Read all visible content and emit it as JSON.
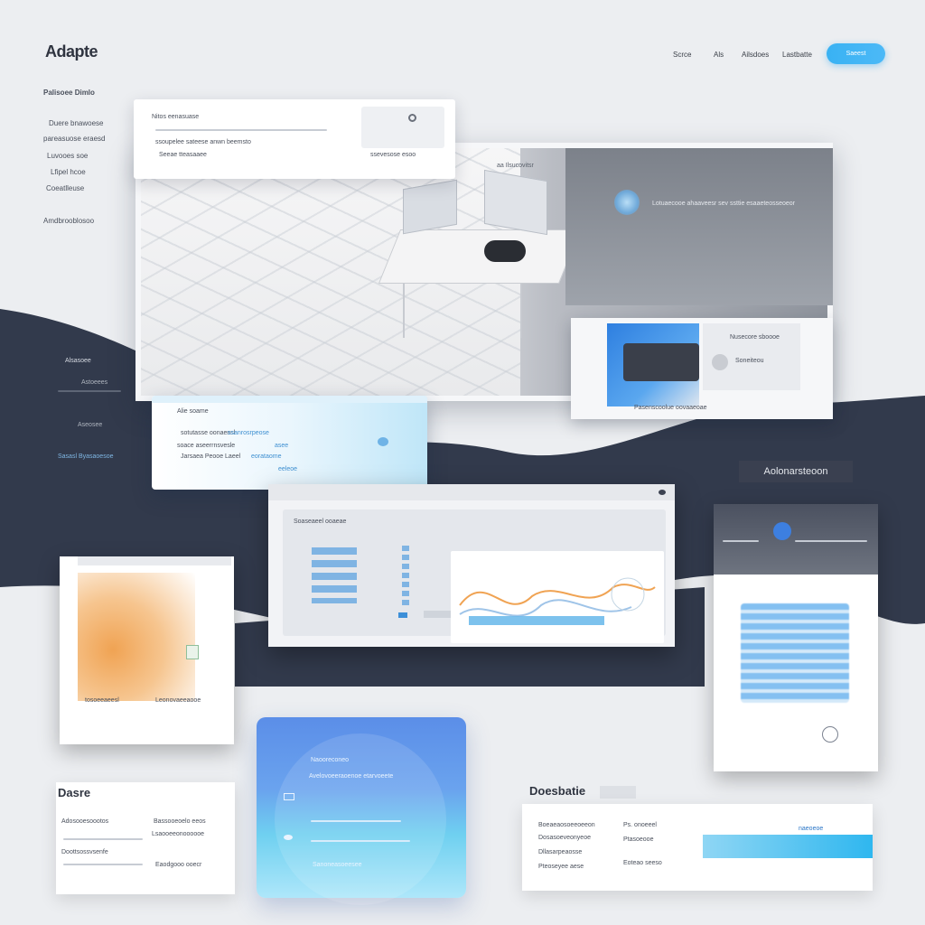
{
  "header": {
    "logo": "Adapte",
    "nav": [
      "Scrce",
      "Als",
      "Ailsdoes",
      "Lastbatte"
    ],
    "cta_label": "Saeest"
  },
  "sidebar": {
    "heading": "Palisoee Dimlo",
    "lines": [
      "Duere bnawoese",
      "pareasuose eraesd",
      "Luvooes soe",
      "Lfipel hcoe",
      "Coeatlleuse"
    ],
    "footer": "Amdbrooblosoo"
  },
  "top_card": {
    "title": "Nitos eenasuase",
    "line": "ssoupelee sateese anwn beemsto",
    "left_label": "Seeae tteasaaee",
    "right_label": "ssevesose esoo"
  },
  "hero": {
    "caption": "aa Ilsucovitsr",
    "headline": "Lotuaecooe ahaaveesr sev ssttie esaaeteosseoeor",
    "inset_label": "Nusecore sboooe",
    "inset_btn": "Soneiteou",
    "inset_row": "Pasenscoolue oovaaeoae"
  },
  "dark_section": {
    "title": "Alsasoee",
    "line1": "Astoeees",
    "line2": "Aseosee",
    "link": "Sasasl Byasaoesoe"
  },
  "blue_panel": {
    "title": "Alie soame",
    "rows": [
      "sotutasse oonaensl",
      "soace aseerrnsvesle",
      "Jarsaea Peooe Laeel"
    ],
    "right": [
      "ssanrosrpeose",
      "asee",
      "eorataome",
      "eeleoe"
    ]
  },
  "chart_card": {
    "title": "Soaseaeel ooaeae"
  },
  "label_chip": "Aolonarsteoon",
  "orange_card": {
    "label1": "tosoeeaeesl",
    "label2": "Leonovaeeaooe"
  },
  "blue_blob": {
    "title": "Naooreconeo",
    "subtitle": "Avelovoeeraoenoe etarvoeete",
    "line": "Sanoneasoeesee"
  },
  "bottom_left": {
    "heading": "Dasre",
    "title": "Adosooesoootos",
    "rows": [
      "Bassooeoelo eeos",
      "Lsaooeeonoooooe",
      "Doottsossvsenfe",
      "Eaodgooo ooecr"
    ]
  },
  "bottom_right": {
    "heading": "Doesbatie",
    "rows": [
      "Boeaeaosoeeoeeon",
      "Dosasoeveonyeoe",
      "Dllasarpeaosse",
      "Pteoseyee aese"
    ],
    "side": [
      "Ps. onoeeel",
      "Ptasoeooe",
      "Eoteao seeso"
    ],
    "tag": "naeoeoe"
  }
}
